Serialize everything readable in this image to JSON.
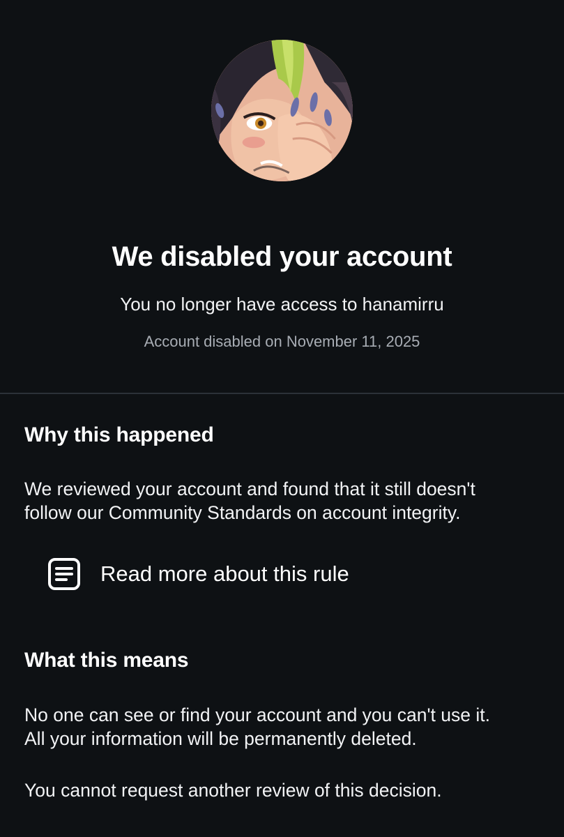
{
  "profile": {
    "avatar_alt": "profile picture"
  },
  "header": {
    "title": "We disabled your account",
    "subtitle": "You no longer have access to hanamirru",
    "disabled_on": "Account disabled on November 11, 2025"
  },
  "why": {
    "heading": "Why this happened",
    "lines": [
      "We reviewed your account and found that it still doesn't",
      "follow our Community Standards on account integrity."
    ],
    "rule_link": "Read more about this rule",
    "rule_icon": "document-icon"
  },
  "meaning": {
    "heading": "What this means",
    "lines": [
      "No one can see or find your account and you can't use it.",
      "All your information will be permanently deleted."
    ],
    "review_note": "You cannot request another review of this decision."
  }
}
